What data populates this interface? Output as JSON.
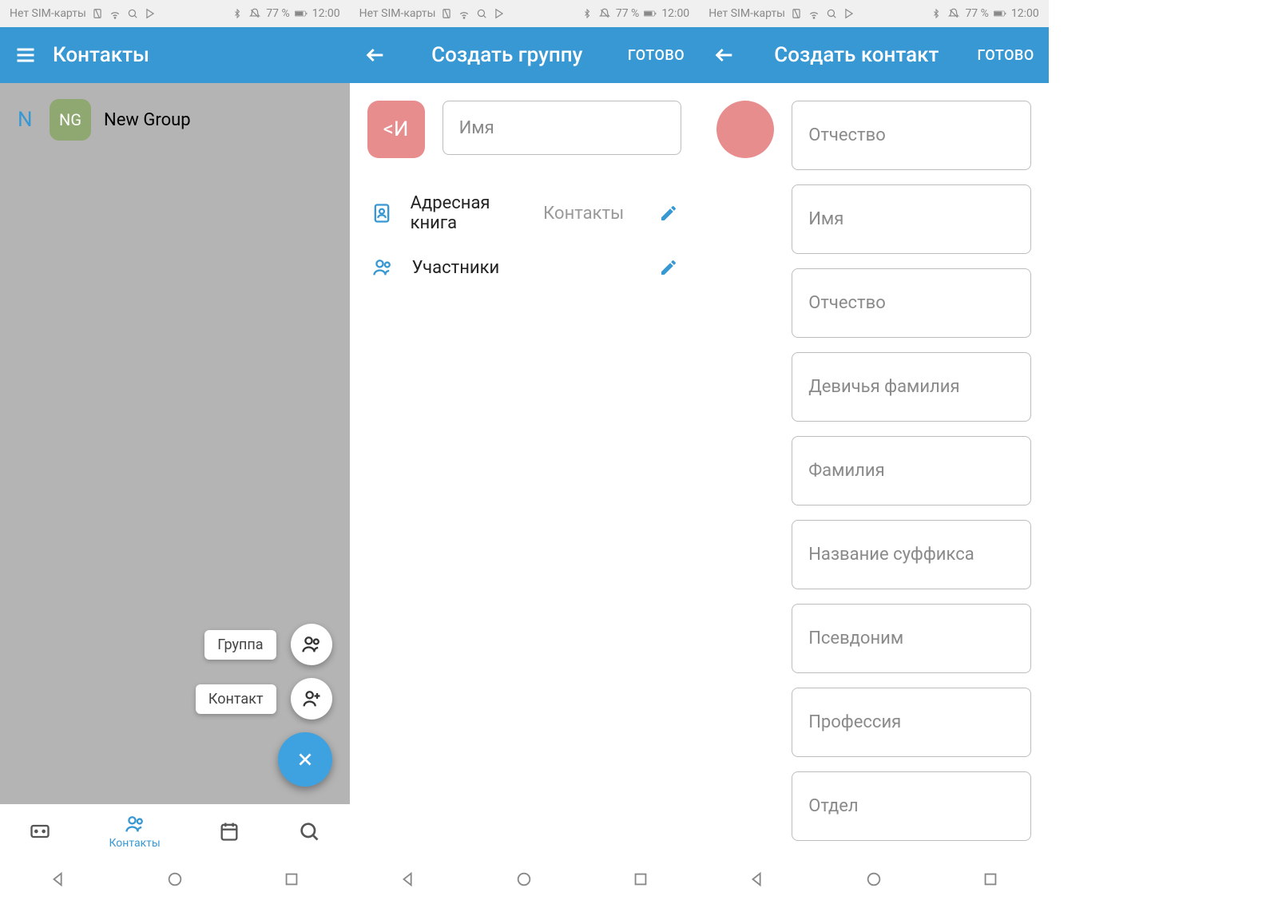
{
  "status_bar": {
    "sim": "Нет SIM-карты",
    "battery": "77 %",
    "time": "12:00"
  },
  "screen1": {
    "title": "Контакты",
    "section_letter": "N",
    "group_initials": "NG",
    "group_name": "New Group",
    "fab_group": "Группа",
    "fab_contact": "Контакт",
    "nav_contacts": "Контакты"
  },
  "screen2": {
    "title": "Создать группу",
    "done": "ГОТОВО",
    "avatar_text": "<И",
    "name_placeholder": "Имя",
    "addressbook_label": "Адресная книга",
    "addressbook_value": "Контакты",
    "participants_label": "Участники"
  },
  "screen3": {
    "title": "Создать контакт",
    "done": "ГОТОВО",
    "fields": [
      "Отчество",
      "Имя",
      "Отчество",
      "Девичья фамилия",
      "Фамилия",
      "Название суффикса",
      "Псевдоним",
      "Профессия",
      "Отдел"
    ]
  }
}
